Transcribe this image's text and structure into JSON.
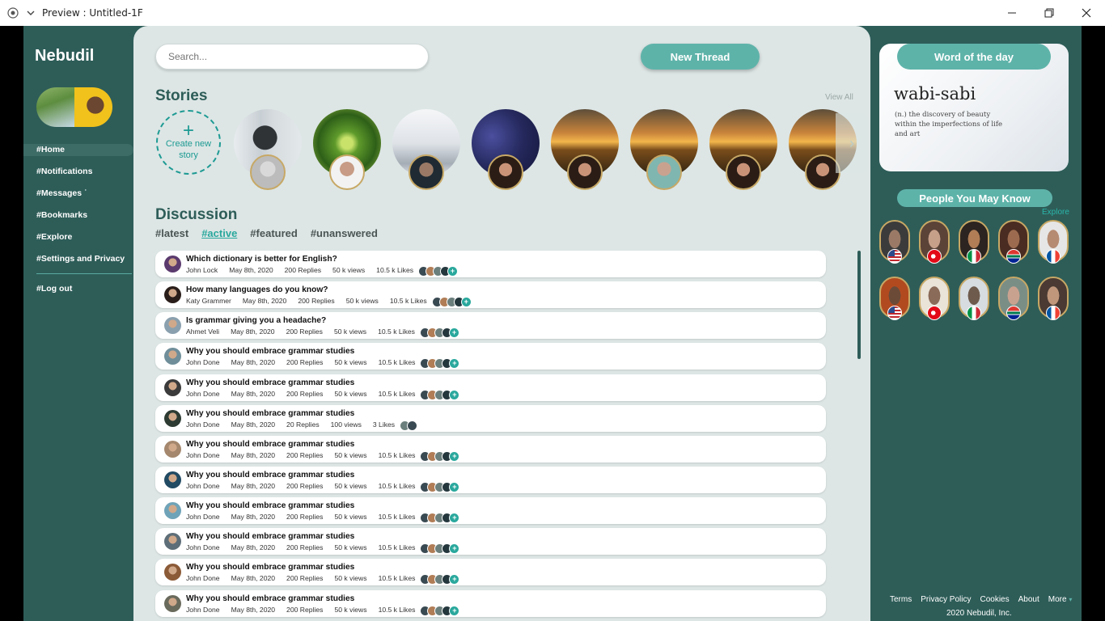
{
  "window": {
    "title": "Preview : Untitled-1F"
  },
  "sidebar": {
    "brand": "Nebudil",
    "items": [
      {
        "label": "#Home"
      },
      {
        "label": "#Notifications"
      },
      {
        "label": "#Messages ˙"
      },
      {
        "label": "#Bookmarks"
      },
      {
        "label": "#Explore"
      },
      {
        "label": "#Settings and Privacy"
      }
    ],
    "logout": "#Log out"
  },
  "header": {
    "search_placeholder": "Search...",
    "new_thread": "New Thread"
  },
  "stories": {
    "title": "Stories",
    "view_all": "View All",
    "create_label": "Create new story",
    "create_icon": "plus-icon"
  },
  "discussion": {
    "title": "Discussion",
    "filters": [
      "#latest",
      "#active",
      "#featured",
      "#unanswered"
    ],
    "threads": [
      {
        "title": "Which dictionary is better for English?",
        "author": "John Lock",
        "date": "May 8th, 2020",
        "replies": "200 Replies",
        "views": "50 k views",
        "likes": "10.5 k Likes"
      },
      {
        "title": "How many languages do you know?",
        "author": "Katy Grammer",
        "date": "May 8th, 2020",
        "replies": "200 Replies",
        "views": "50 k views",
        "likes": "10.5 k Likes"
      },
      {
        "title": "Is grammar giving you a headache?",
        "author": "Ahmet Veli",
        "date": "May 8th, 2020",
        "replies": "200 Replies",
        "views": "50 k views",
        "likes": "10.5 k Likes"
      },
      {
        "title": "Why you should embrace grammar studies",
        "author": "John Done",
        "date": "May 8th, 2020",
        "replies": "200 Replies",
        "views": "50 k views",
        "likes": "10.5 k Likes"
      },
      {
        "title": "Why you should embrace grammar studies",
        "author": "John Done",
        "date": "May 8th, 2020",
        "replies": "200 Replies",
        "views": "50 k views",
        "likes": "10.5 k Likes"
      },
      {
        "title": "Why you should embrace grammar studies",
        "author": "John Done",
        "date": "May 8th, 2020",
        "replies": "20 Replies",
        "views": "100 views",
        "likes": "3 Likes"
      },
      {
        "title": "Why you should embrace grammar studies",
        "author": "John Done",
        "date": "May 8th, 2020",
        "replies": "200 Replies",
        "views": "50 k views",
        "likes": "10.5 k Likes"
      },
      {
        "title": "Why you should embrace grammar studies",
        "author": "John Done",
        "date": "May 8th, 2020",
        "replies": "200 Replies",
        "views": "50 k views",
        "likes": "10.5 k Likes"
      },
      {
        "title": "Why you should embrace grammar studies",
        "author": "John Done",
        "date": "May 8th, 2020",
        "replies": "200 Replies",
        "views": "50 k views",
        "likes": "10.5 k Likes"
      },
      {
        "title": "Why you should embrace grammar studies",
        "author": "John Done",
        "date": "May 8th, 2020",
        "replies": "200 Replies",
        "views": "50 k views",
        "likes": "10.5 k Likes"
      },
      {
        "title": "Why you should embrace grammar studies",
        "author": "John Done",
        "date": "May 8th, 2020",
        "replies": "200 Replies",
        "views": "50 k views",
        "likes": "10.5 k Likes"
      },
      {
        "title": "Why you should embrace grammar studies",
        "author": "John Done",
        "date": "May 8th, 2020",
        "replies": "200 Replies",
        "views": "50 k views",
        "likes": "10.5 k Likes"
      }
    ]
  },
  "word_of_day": {
    "label": "Word of the day",
    "word": "wabi-sabi",
    "definition": "(n.) the discovery of beauty within the imperfections of life and art"
  },
  "people": {
    "title": "People You May Know",
    "explore": "Explore",
    "flags": [
      "us-flag-icon",
      "turkey-flag-icon",
      "italy-flag-icon",
      "south-africa-flag-icon",
      "france-flag-icon"
    ]
  },
  "footer": {
    "links": [
      "Terms",
      "Privacy Policy",
      "Cookies",
      "About",
      "More"
    ],
    "copyright": "2020 Nebudil, Inc."
  },
  "colors": {
    "accent": "#5eb3a9",
    "panel": "#2e5d58",
    "main_bg": "#dde6e5",
    "link_active": "#2aa89d"
  }
}
